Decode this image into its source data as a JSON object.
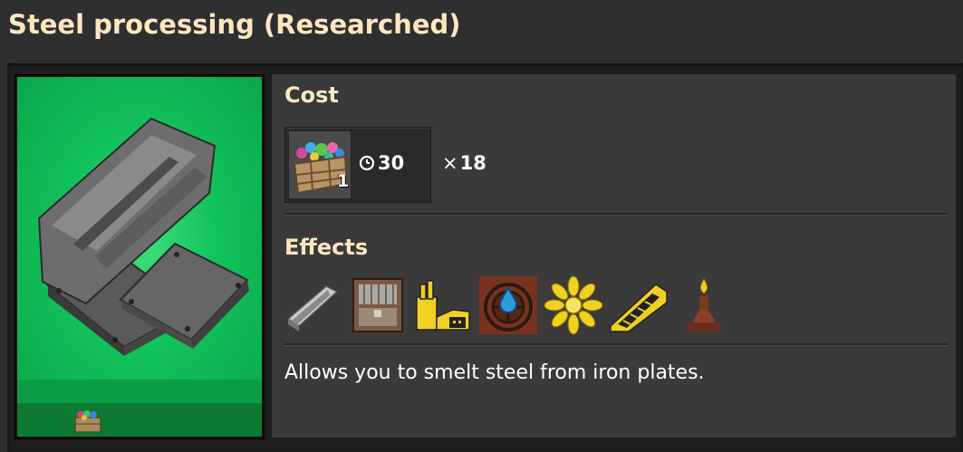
{
  "window": {
    "title": "Steel processing (Researched)"
  },
  "technology_card": {
    "icon": "steel-beam-and-plates-icon",
    "pack_icon": "automation-science-pack-icon",
    "colors": {
      "background": "#12c25a",
      "band_light": "#0b9d44",
      "band_dark": "#0c7a30"
    }
  },
  "cost": {
    "heading": "Cost",
    "pack_icon": "automation-science-pack-icon",
    "pack_count": "1",
    "time_icon": "clock-icon",
    "time": "30",
    "multiplier_symbol": "×",
    "multiplier": "18"
  },
  "effects": {
    "heading": "Effects",
    "icons": [
      "steel-plate-icon",
      "steel-chest-icon",
      "steel-furnace-icon",
      "offshore-pump-icon",
      "yellow-gear-icon",
      "fast-belt-icon",
      "oil-lamp-icon"
    ]
  },
  "description": "Allows you to smelt steel from iron plates.",
  "colors": {
    "heading": "#ffe6c0",
    "panel": "#3a3a3a",
    "frame": "#1e1e1e"
  }
}
